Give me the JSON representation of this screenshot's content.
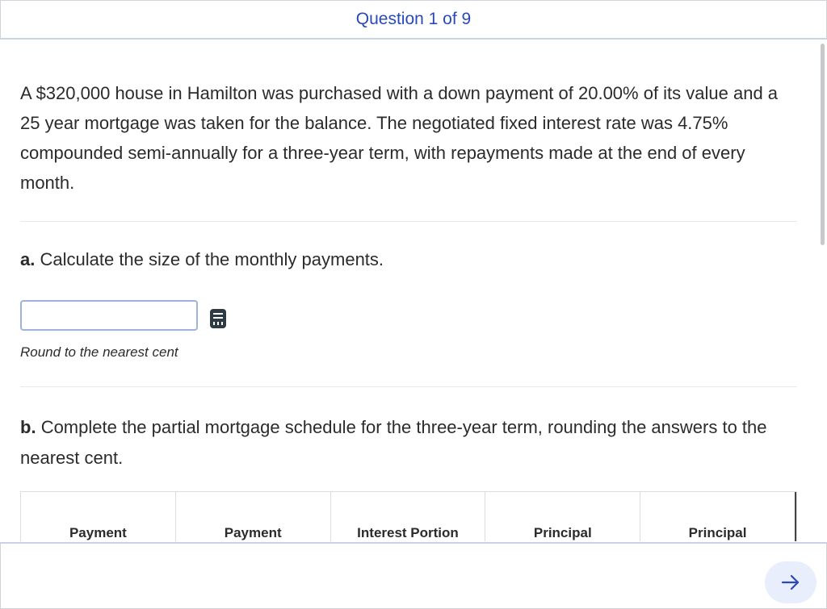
{
  "header": {
    "title": "Question 1 of 9"
  },
  "problem": {
    "text": "A $320,000 house in Hamilton was purchased with a down payment of 20.00% of its value and a 25 year mortgage was taken for the balance. The negotiated fixed interest rate was 4.75% compounded semi-annually for a three-year term, with repayments made at the end of every month."
  },
  "part_a": {
    "letter": "a.",
    "prompt": "Calculate the size of the monthly payments.",
    "input_value": "",
    "hint": "Round to the nearest cent"
  },
  "part_b": {
    "letter": "b.",
    "prompt": "Complete the partial mortgage schedule for the three-year term, rounding the answers to the nearest cent."
  },
  "table": {
    "columns": [
      "Payment",
      "Payment",
      "Interest Portion",
      "Principal",
      "Principal"
    ]
  },
  "footer": {
    "next_icon": "arrow-right-icon"
  },
  "colors": {
    "accent": "#2a49b8",
    "next_bg": "#e8eefb"
  }
}
